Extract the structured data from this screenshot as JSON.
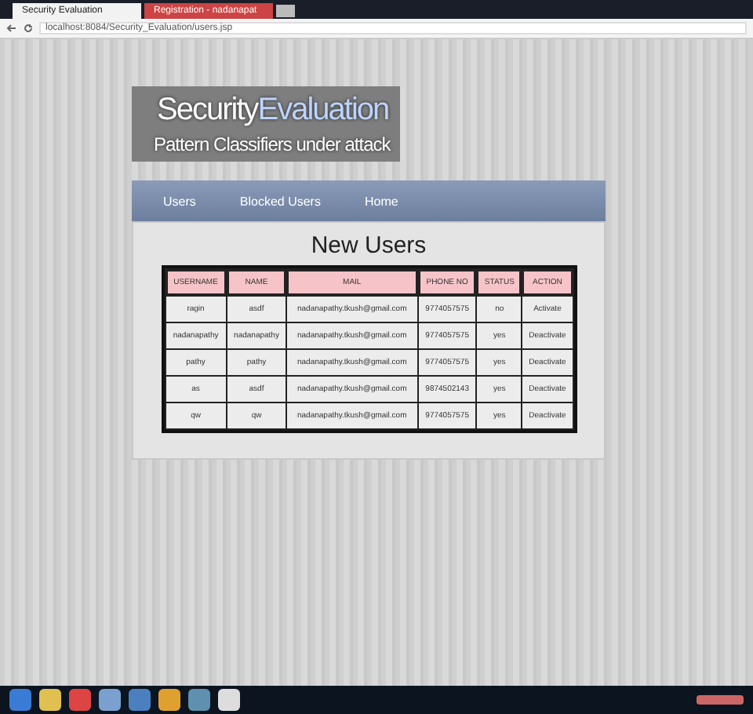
{
  "browser": {
    "tabs": [
      {
        "title": "Security Evaluation",
        "selected": true
      },
      {
        "title": "Registration - nadanapat",
        "selected": false
      }
    ],
    "url": "localhost:8084/Security_Evaluation/users.jsp"
  },
  "site": {
    "title_plain": "Security",
    "title_accent": "Evaluation",
    "subtitle": "Pattern Classifiers under attack"
  },
  "nav": [
    "Users",
    "Blocked Users",
    "Home"
  ],
  "table": {
    "title": "New Users",
    "columns": [
      "USERNAME",
      "NAME",
      "MAIL",
      "PHONE NO",
      "STATUS",
      "ACTION"
    ],
    "rows": [
      {
        "cells": [
          "ragin",
          "asdf",
          "nadanapathy.tkush@gmail.com",
          "9774057575",
          "no"
        ],
        "action": "Activate"
      },
      {
        "cells": [
          "nadanapathy",
          "nadanapathy",
          "nadanapathy.tkush@gmail.com",
          "9774057575",
          "yes"
        ],
        "action": "Deactivate"
      },
      {
        "cells": [
          "pathy",
          "pathy",
          "nadanapathy.tkush@gmail.com",
          "9774057575",
          "yes"
        ],
        "action": "Deactivate"
      },
      {
        "cells": [
          "as",
          "asdf",
          "nadanapathy.tkush@gmail.com",
          "9874502143",
          "yes"
        ],
        "action": "Deactivate"
      },
      {
        "cells": [
          "qw",
          "qw",
          "nadanapathy.tkush@gmail.com",
          "9774057575",
          "yes"
        ],
        "action": "Deactivate"
      }
    ]
  }
}
